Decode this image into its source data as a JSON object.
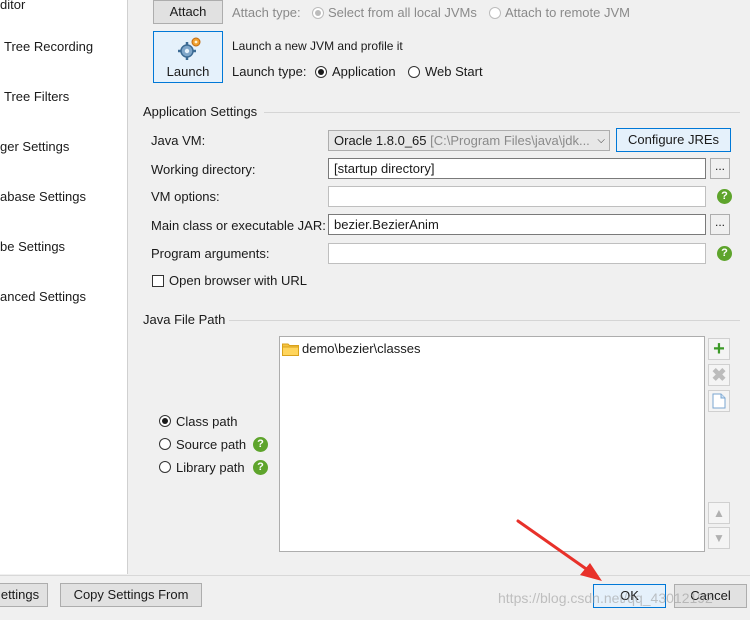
{
  "nav": {
    "items": [
      "ditor",
      "Tree Recording",
      "Tree Filters",
      "ger Settings",
      "abase Settings",
      "be Settings",
      "anced Settings"
    ]
  },
  "attach": {
    "button_label": "Attach",
    "type_label": "Attach type:",
    "opt_local": "Select from all local JVMs",
    "opt_remote": "Attach to remote JVM"
  },
  "launch": {
    "button_label": "Launch",
    "description": "Launch a new JVM and profile it",
    "type_label": "Launch type:",
    "opt_application": "Application",
    "opt_webstart": "Web Start"
  },
  "app_settings": {
    "title": "Application Settings",
    "java_vm_label": "Java VM:",
    "java_vm_value": "Oracle 1.8.0_65",
    "java_vm_path": "[C:\\Program Files\\java\\jdk...",
    "configure_jres": "Configure JREs",
    "working_dir_label": "Working directory:",
    "working_dir_value": "[startup directory]",
    "vm_options_label": "VM options:",
    "vm_options_value": "",
    "main_class_label": "Main class or executable JAR:",
    "main_class_value": "bezier.BezierAnim",
    "program_args_label": "Program arguments:",
    "program_args_value": "",
    "open_browser_label": "Open browser with URL",
    "ellipsis": "..."
  },
  "file_path": {
    "title": "Java File Path",
    "entries": [
      "demo\\bezier\\classes"
    ],
    "class_path": "Class path",
    "source_path": "Source path",
    "library_path": "Library path"
  },
  "footer": {
    "settings": "ettings",
    "copy_settings": "Copy Settings From",
    "ok": "OK",
    "cancel": "Cancel"
  },
  "watermark": "https://blog.csdn.net/qq_43012192",
  "colors": {
    "help_green": "#5ea42c",
    "arrow_red": "#e8312a",
    "focus_blue": "#0078d7"
  }
}
